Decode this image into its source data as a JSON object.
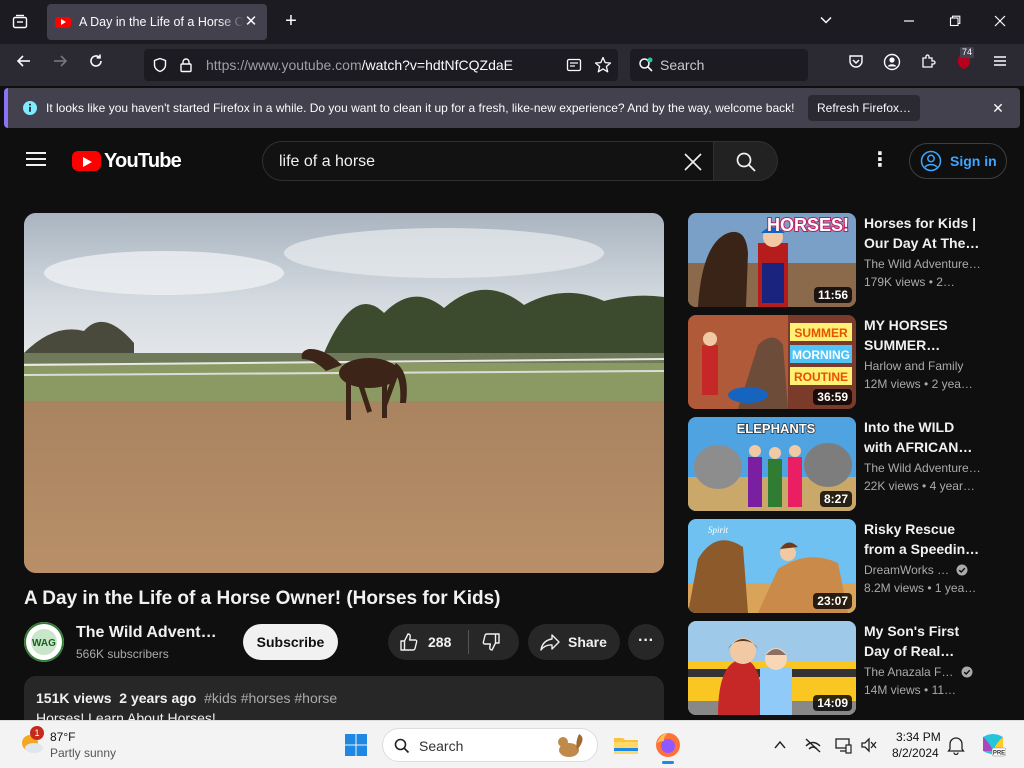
{
  "browser": {
    "tab_title": "A Day in the Life of a Horse Owner! (Horses for Kids) - YouTube",
    "url_host": "https://www.youtube.com",
    "url_path": "/watch?v=hdtNfCQZdaE",
    "search_placeholder": "Search",
    "extension_badge": "74"
  },
  "notification": {
    "message": "It looks like you haven't started Firefox in a while. Do you want to clean it up for a fresh, like-new experience? And by the way, welcome back!",
    "button": "Refresh Firefox…"
  },
  "youtube": {
    "logo_text": "YouTube",
    "search_query": "life of a horse",
    "sign_in": "Sign in",
    "video": {
      "title": "A Day in the Life of a Horse Owner! (Horses for Kids)",
      "channel": "The Wild Adventure Girls",
      "subscribers": "566K subscribers",
      "subscribe": "Subscribe",
      "likes": "288",
      "share": "Share",
      "views": "151K views",
      "age": "2 years ago",
      "tags": "#kids #horses #horse",
      "description": "Horses! Learn About Horses!"
    },
    "recommendations": [
      {
        "title1": "Horses for Kids |",
        "title2": "Our Day At The…",
        "channel": "The Wild Adventure…",
        "views": "179K views",
        "age": "• 2…",
        "duration": "11:56",
        "verified": false
      },
      {
        "title1": "MY HORSES",
        "title2": "SUMMER…",
        "channel": "Harlow and Family",
        "views": "12M views",
        "age": "• 2 yea…",
        "duration": "36:59",
        "verified": false
      },
      {
        "title1": "Into the WILD",
        "title2": "with AFRICAN…",
        "channel": "The Wild Adventure…",
        "views": "22K views",
        "age": "• 4 year…",
        "duration": "8:27",
        "verified": false
      },
      {
        "title1": "Risky Rescue",
        "title2": "from a Speedin…",
        "channel": "DreamWorks …",
        "views": "8.2M views",
        "age": "• 1 yea…",
        "duration": "23:07",
        "verified": true
      },
      {
        "title1": "My Son's First",
        "title2": "Day of Real…",
        "channel": "The Anazala F…",
        "views": "14M views",
        "age": "• 11…",
        "duration": "14:09",
        "verified": true
      }
    ],
    "thumb_texts": {
      "t1": "HORSES!",
      "t2a": "SUMMER",
      "t2b": "MORNING",
      "t2c": "ROUTINE",
      "t3": "ELEPHANTS"
    }
  },
  "taskbar": {
    "weather_temp": "87°F",
    "weather_desc": "Partly sunny",
    "weather_badge": "1",
    "search_label": "Search",
    "time": "3:34 PM",
    "date": "8/2/2024"
  }
}
